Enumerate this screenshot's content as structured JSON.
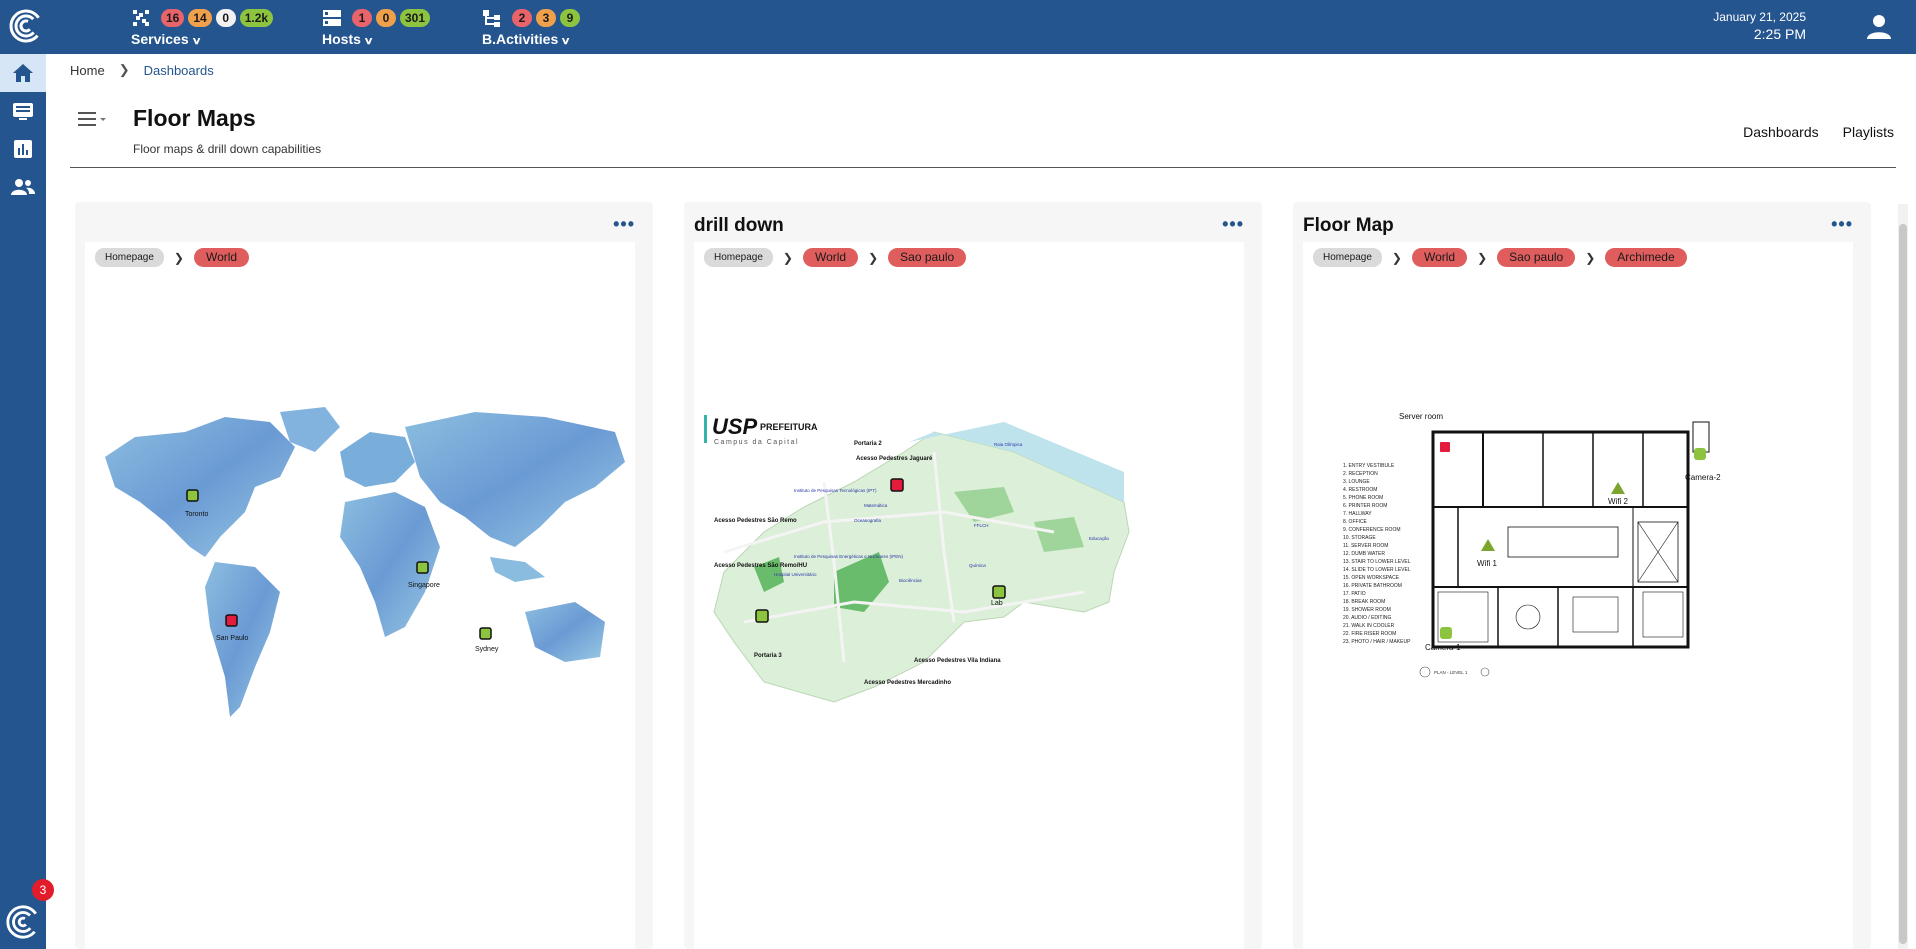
{
  "topbar": {
    "groups": [
      {
        "label": "Services",
        "icon": "services-grid-icon",
        "counts": [
          {
            "value": "16",
            "color": "#e8646a"
          },
          {
            "value": "14",
            "color": "#f0a04b"
          },
          {
            "value": "0",
            "color": "#f2f2f2"
          },
          {
            "value": "1.2k",
            "color": "#8dc43f"
          }
        ]
      },
      {
        "label": "Hosts",
        "icon": "hosts-server-icon",
        "counts": [
          {
            "value": "1",
            "color": "#e8646a"
          },
          {
            "value": "0",
            "color": "#f0a04b"
          },
          {
            "value": "301",
            "color": "#8dc43f"
          }
        ]
      },
      {
        "label": "B.Activities",
        "icon": "business-activities-icon",
        "counts": [
          {
            "value": "2",
            "color": "#e8646a"
          },
          {
            "value": "3",
            "color": "#f0a04b"
          },
          {
            "value": "9",
            "color": "#8dc43f"
          }
        ]
      }
    ],
    "date": "January 21, 2025",
    "time": "2:25 PM"
  },
  "sidebar": {
    "items": [
      "home-icon",
      "monitor-icon",
      "bar-chart-icon",
      "users-icon"
    ],
    "notification_count": "3"
  },
  "breadcrumb": {
    "home": "Home",
    "current": "Dashboards"
  },
  "header": {
    "title": "Floor Maps",
    "subtitle": "Floor maps & drill down capabilities",
    "links": [
      "Dashboards",
      "Playlists"
    ]
  },
  "panels": [
    {
      "title": "",
      "crumbs": [
        "Homepage",
        "World"
      ],
      "markers": [
        {
          "label": "Toronto",
          "status": "ok"
        },
        {
          "label": "Singapore",
          "status": "ok"
        },
        {
          "label": "San Paulo",
          "status": "critical"
        },
        {
          "label": "Sydney",
          "status": "ok"
        }
      ]
    },
    {
      "title": "drill down",
      "crumbs": [
        "Homepage",
        "World",
        "Sao paulo"
      ],
      "map_header": "USP",
      "map_header_sub": "PREFEITURA",
      "map_caption": "Campus da Capital",
      "map_labels": [
        "Portaria 2",
        "Acesso Pedestres Jaguaré",
        "Acesso Pedestres São Remo",
        "Acesso Pedestres São Remo/HU",
        "Portaria 3",
        "Acesso Pedestres Vila Indiana",
        "Acesso Pedestres Mercadinho",
        "Instituto de Pesquisas Tecnológicas (IPT)",
        "Instituto de Pesquisas Energéticas e Nucleares (IPEN)",
        "Hospital Universitário",
        "Oceanografia",
        "Matemática",
        "Biociências",
        "Química",
        "FFLCH",
        "Educação",
        "Raia Olímpica"
      ],
      "markers": [
        {
          "label": "Lab",
          "status": "ok"
        }
      ]
    },
    {
      "title": "Floor Map",
      "crumbs": [
        "Homepage",
        "World",
        "Sao paulo",
        "Archimede"
      ],
      "room_list": [
        "1. ENTRY VESTIBULE",
        "2. RECEPTION",
        "3. LOUNGE",
        "4. RESTROOM",
        "5. PHONE ROOM",
        "6. PRINTER ROOM",
        "7. HALLWAY",
        "8. OFFICE",
        "9. CONFERENCE ROOM",
        "10. STORAGE",
        "11. SERVER ROOM",
        "12. DUMB WATER",
        "13. STAIR TO LOWER LEVEL",
        "14. SLIDE TO LOWER LEVEL",
        "15. OPEN WORKSPACE",
        "16. PRIVATE BATHROOM",
        "17. PATIO",
        "18. BREAK ROOM",
        "19. SHOWER ROOM",
        "20. AUDIO / EDITING",
        "21. WALK IN COOLER",
        "22. FIRE RISER ROOM",
        "23. PHOTO / HAIR / MAKEUP"
      ],
      "plan_label": "PLAN - LEVEL 1",
      "markers": [
        {
          "label": "Server room",
          "status": "critical"
        },
        {
          "label": "Camera-2",
          "status": "ok"
        },
        {
          "label": "Wifi 2",
          "status": "ok"
        },
        {
          "label": "Wifi 1",
          "status": "ok"
        },
        {
          "label": "Camera-1",
          "status": "ok"
        }
      ]
    }
  ],
  "colors": {
    "brand": "#24558f",
    "status_ok": "#8dc43f",
    "status_critical": "#e31c3d",
    "crumb": "#e05d5d"
  }
}
